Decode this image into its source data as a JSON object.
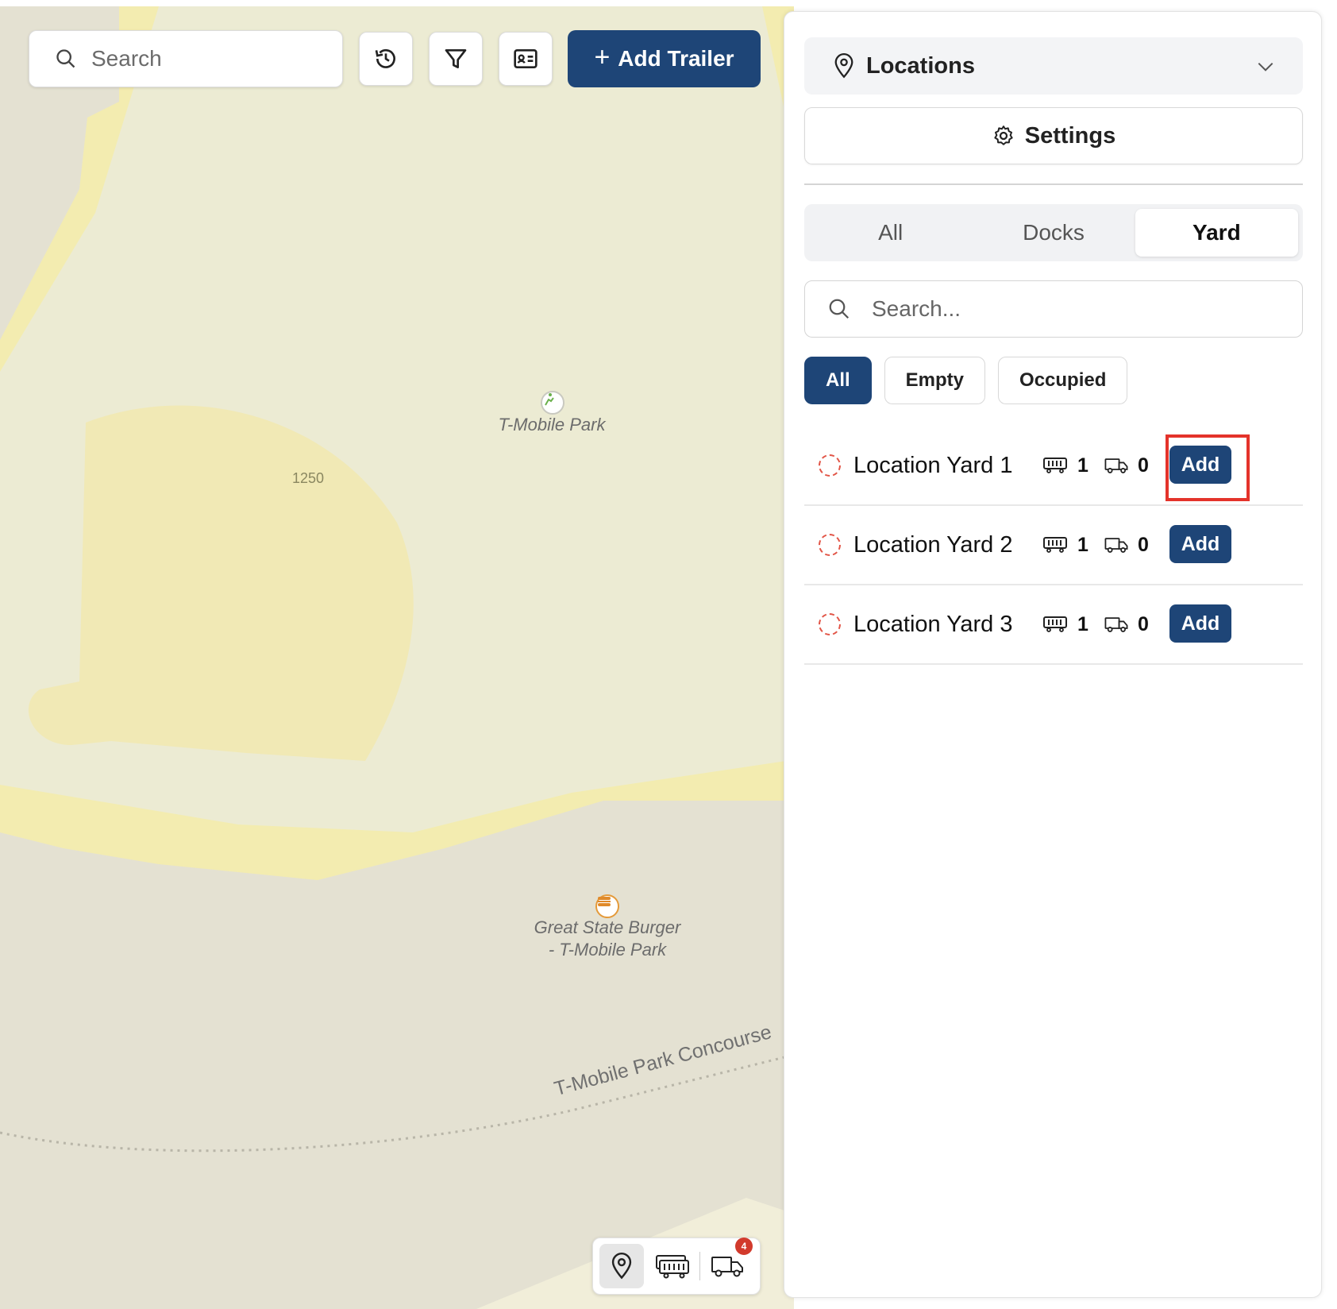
{
  "map": {
    "labels": {
      "stadium": "T-Mobile Park",
      "number": "1250",
      "restaurant_line1": "Great State Burger",
      "restaurant_line2": "- T-Mobile Park",
      "concourse": "T-Mobile Park Concourse"
    },
    "colors": {
      "land": "#e4e1d2",
      "park": "#f3ecb0",
      "field": "#f1e9b8",
      "plaza": "#ecebd6"
    }
  },
  "toolbar": {
    "search_placeholder": "Search",
    "history_icon": "history-icon",
    "filter_icon": "filter-icon",
    "card_icon": "id-card-icon",
    "add_trailer_label": "Add Trailer",
    "accent": "#1e4577"
  },
  "dock": {
    "items": [
      "location-pin-icon",
      "trailer-icon",
      "truck-icon"
    ],
    "truck_badge": "4"
  },
  "panel": {
    "location_select_label": "Locations",
    "settings_label": "Settings",
    "tabs": [
      {
        "label": "All",
        "active": false
      },
      {
        "label": "Docks",
        "active": false
      },
      {
        "label": "Yard",
        "active": true
      }
    ],
    "search_placeholder": "Search...",
    "filters": [
      {
        "label": "All",
        "active": true
      },
      {
        "label": "Empty",
        "active": false
      },
      {
        "label": "Occupied",
        "active": false
      }
    ],
    "yards": [
      {
        "name": "Location Yard 1",
        "trailers": "1",
        "trucks": "0",
        "action": "Add"
      },
      {
        "name": "Location Yard 2",
        "trailers": "1",
        "trucks": "0",
        "action": "Add"
      },
      {
        "name": "Location Yard 3",
        "trailers": "1",
        "trucks": "0",
        "action": "Add"
      }
    ],
    "highlight_color": "#e4332b"
  }
}
